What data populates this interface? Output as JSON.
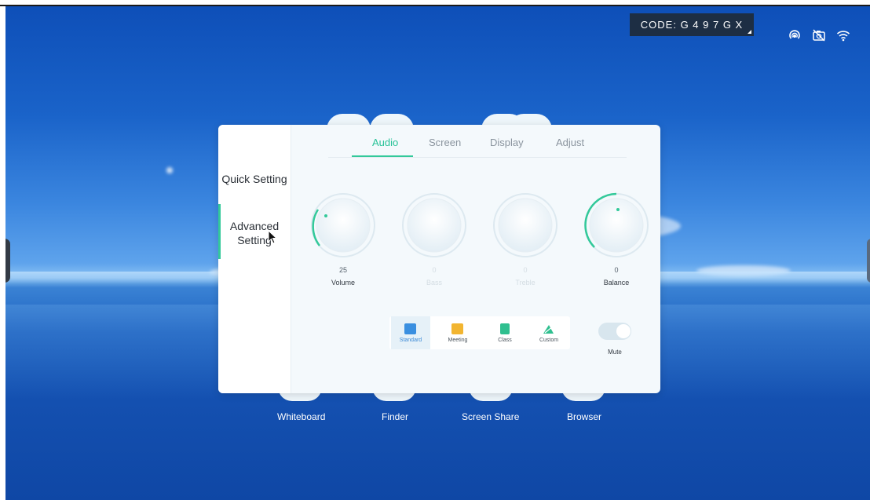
{
  "status_bar": {
    "code_text": "CODE: G 4 9 7 G X",
    "icons": [
      "hotspot-icon",
      "camera-off-icon",
      "wifi-icon"
    ]
  },
  "panel": {
    "sidebar": {
      "quick_setting": "Quick Setting",
      "advanced_setting_line1": "Advanced",
      "advanced_setting_line2": "Setting"
    },
    "tabs": [
      {
        "label": "Audio",
        "active": true
      },
      {
        "label": "Screen",
        "active": false
      },
      {
        "label": "Display",
        "active": false
      },
      {
        "label": "Adjust",
        "active": false
      }
    ],
    "knobs": [
      {
        "label": "Volume",
        "value": "25",
        "enabled": true
      },
      {
        "label": "Bass",
        "value": "0",
        "enabled": false
      },
      {
        "label": "Treble",
        "value": "0",
        "enabled": false
      },
      {
        "label": "Balance",
        "value": "0",
        "enabled": true
      }
    ],
    "sound_modes": [
      {
        "label": "Standard",
        "icon": "standard-mode-icon",
        "color": "#3a8fe0",
        "selected": true
      },
      {
        "label": "Meeting",
        "icon": "meeting-mode-icon",
        "color": "#f2b531",
        "selected": false
      },
      {
        "label": "Class",
        "icon": "class-mode-icon",
        "color": "#2fbf8f",
        "selected": false
      },
      {
        "label": "Custom",
        "icon": "custom-mode-icon",
        "color": "#2fbf8f",
        "selected": false
      }
    ],
    "mute": {
      "label": "Mute",
      "on": false
    }
  },
  "dock": [
    {
      "label": "Whiteboard"
    },
    {
      "label": "Finder"
    },
    {
      "label": "Screen Share"
    },
    {
      "label": "Browser"
    }
  ],
  "colors": {
    "accent": "#33c99a",
    "badge_bg": "#1d2e44"
  }
}
